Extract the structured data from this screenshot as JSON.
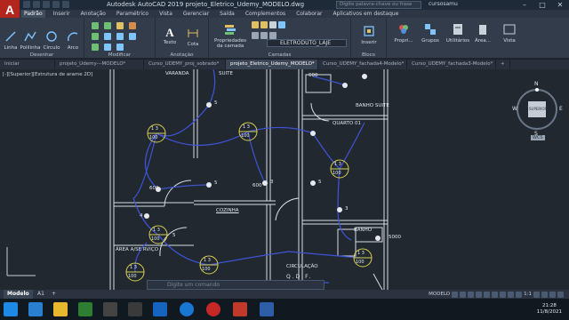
{
  "titlebar": {
    "app_title": "Autodesk AutoCAD 2019   projeto_Eletrico_Udemy_MODELO.dwg",
    "search_placeholder": "Digite palavra-chave ou frase",
    "user": "cursosamu"
  },
  "menu_tabs": [
    "Padrão",
    "Inserir",
    "Anotação",
    "Paramétrico",
    "Vista",
    "Gerenciar",
    "Saída",
    "Complementos",
    "Colaborar",
    "Aplicativos em destaque"
  ],
  "ribbon": {
    "draw": {
      "title": "Desenhar",
      "tools": [
        "Linha",
        "Polilinha",
        "Círculo",
        "Arco"
      ]
    },
    "modify": {
      "title": "Modificar"
    },
    "annotation": {
      "title": "Anotação",
      "tools": [
        "Texto",
        "Cota"
      ]
    },
    "layers": {
      "title": "Camadas",
      "props_label": "Propriedades da camada",
      "current_layer": "ELETRODUTO_LAJE"
    },
    "block": {
      "title": "Bloco",
      "insert_label": "Inserir"
    },
    "properties_label": "Propri...",
    "groups_label": "Grupos",
    "utilities_label": "Utilitários",
    "clipboard_label": "Área...",
    "view_label": "Vista"
  },
  "doc_tabs": [
    "Iniciar",
    "projeto_Udemy---MODELO*",
    "Curso_UDEMY_proj_sobrado*",
    "projeto_Eletrico_Udemy_MODELO*",
    "Curso_UDEMY_fachada4-Modelo*",
    "Curso_UDEMY_fachada3-Modelo*"
  ],
  "active_doc_tab": 3,
  "viewport": {
    "label": "[-][Superior][Estrutura de arame 2D]",
    "rooms": [
      "VARANDA",
      "SUITE",
      "BANHO SUITE",
      "QUARTO 01",
      "COZINHA",
      "BANHO",
      "ÁREA A/SE RVIÇO",
      "CIRCULAÇÃO",
      "Q.D.F."
    ],
    "circuit_symbol_top": "1 3",
    "circuit_symbol_bottom": "100",
    "switch_labels": [
      "5",
      "5",
      "3",
      "3",
      "5",
      "5",
      "4",
      "5000"
    ],
    "point_labels": [
      "600",
      "600",
      "600"
    ],
    "viewcube": {
      "n": "N",
      "s": "S",
      "w": "W",
      "e": "E",
      "face": "SUPERIOR",
      "ucs": "WCS"
    }
  },
  "command_placeholder": "Digite um comando",
  "layout_tabs": [
    "Modelo",
    "A1"
  ],
  "status": {
    "mode": "MODELO",
    "scale": "1:1"
  },
  "taskbar": {
    "time": "21:28",
    "date": "11/8/2021"
  }
}
